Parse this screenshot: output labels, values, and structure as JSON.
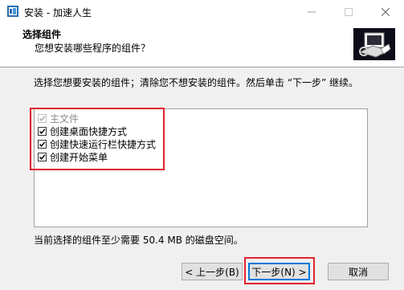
{
  "window": {
    "title": "安装 - 加速人生",
    "minimize_icon": "minimize-icon",
    "maximize_icon": "maximize-icon",
    "close_icon": "close-icon"
  },
  "header": {
    "title": "选择组件",
    "subtitle": "您想安装哪些程序的组件？"
  },
  "main": {
    "instruction": "选择您想要安装的组件；清除您不想安装的组件。然后单击 “下一步” 继续。",
    "components": [
      {
        "label": "主文件",
        "checked": true,
        "disabled": true
      },
      {
        "label": "创建桌面快捷方式",
        "checked": true,
        "disabled": false
      },
      {
        "label": "创建快速运行栏快捷方式",
        "checked": true,
        "disabled": false
      },
      {
        "label": "创建开始菜单",
        "checked": true,
        "disabled": false
      }
    ],
    "disk_space": "当前选择的组件至少需要 50.4 MB 的磁盘空间。"
  },
  "buttons": {
    "back": "< 上一步(B)",
    "next": "下一步(N) >",
    "cancel": "取消"
  },
  "colors": {
    "highlight": "#e0242f",
    "default_button_border": "#0078d7"
  }
}
